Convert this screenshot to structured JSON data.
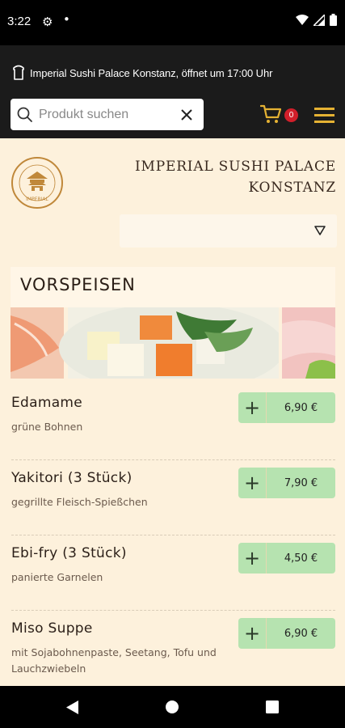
{
  "status": {
    "time": "3:22"
  },
  "header": {
    "info_text": "Imperial Sushi Palace Konstanz, öffnet um 17:00 Uhr",
    "search_placeholder": "Produkt suchen",
    "cart_count": "0",
    "accent_color": "#e5b233"
  },
  "restaurant": {
    "name_line1": "IMPERIAL SUSHI PALACE",
    "name_line2": "KONSTANZ",
    "logo_text": "IMPERIAL"
  },
  "section": {
    "title": "VORSPEISEN"
  },
  "items": [
    {
      "name": "Edamame",
      "desc": "grüne Bohnen",
      "price": "6,90 €"
    },
    {
      "name": "Yakitori (3 Stück)",
      "desc": "gegrillte Fleisch-Spießchen",
      "price": "7,90 €"
    },
    {
      "name": "Ebi-fry (3 Stück)",
      "desc": "panierte Garnelen",
      "price": "4,50 €"
    },
    {
      "name": "Miso Suppe",
      "desc": "mit Sojabohnenpaste, Seetang, Tofu und Lauchzwiebeln",
      "price": "6,90 €"
    }
  ],
  "icons": {
    "shop": "shop-icon",
    "search": "search-icon",
    "clear": "close-icon",
    "cart": "cart-icon",
    "menu": "hamburger-menu-icon",
    "dropdown": "triangle-down-icon"
  }
}
